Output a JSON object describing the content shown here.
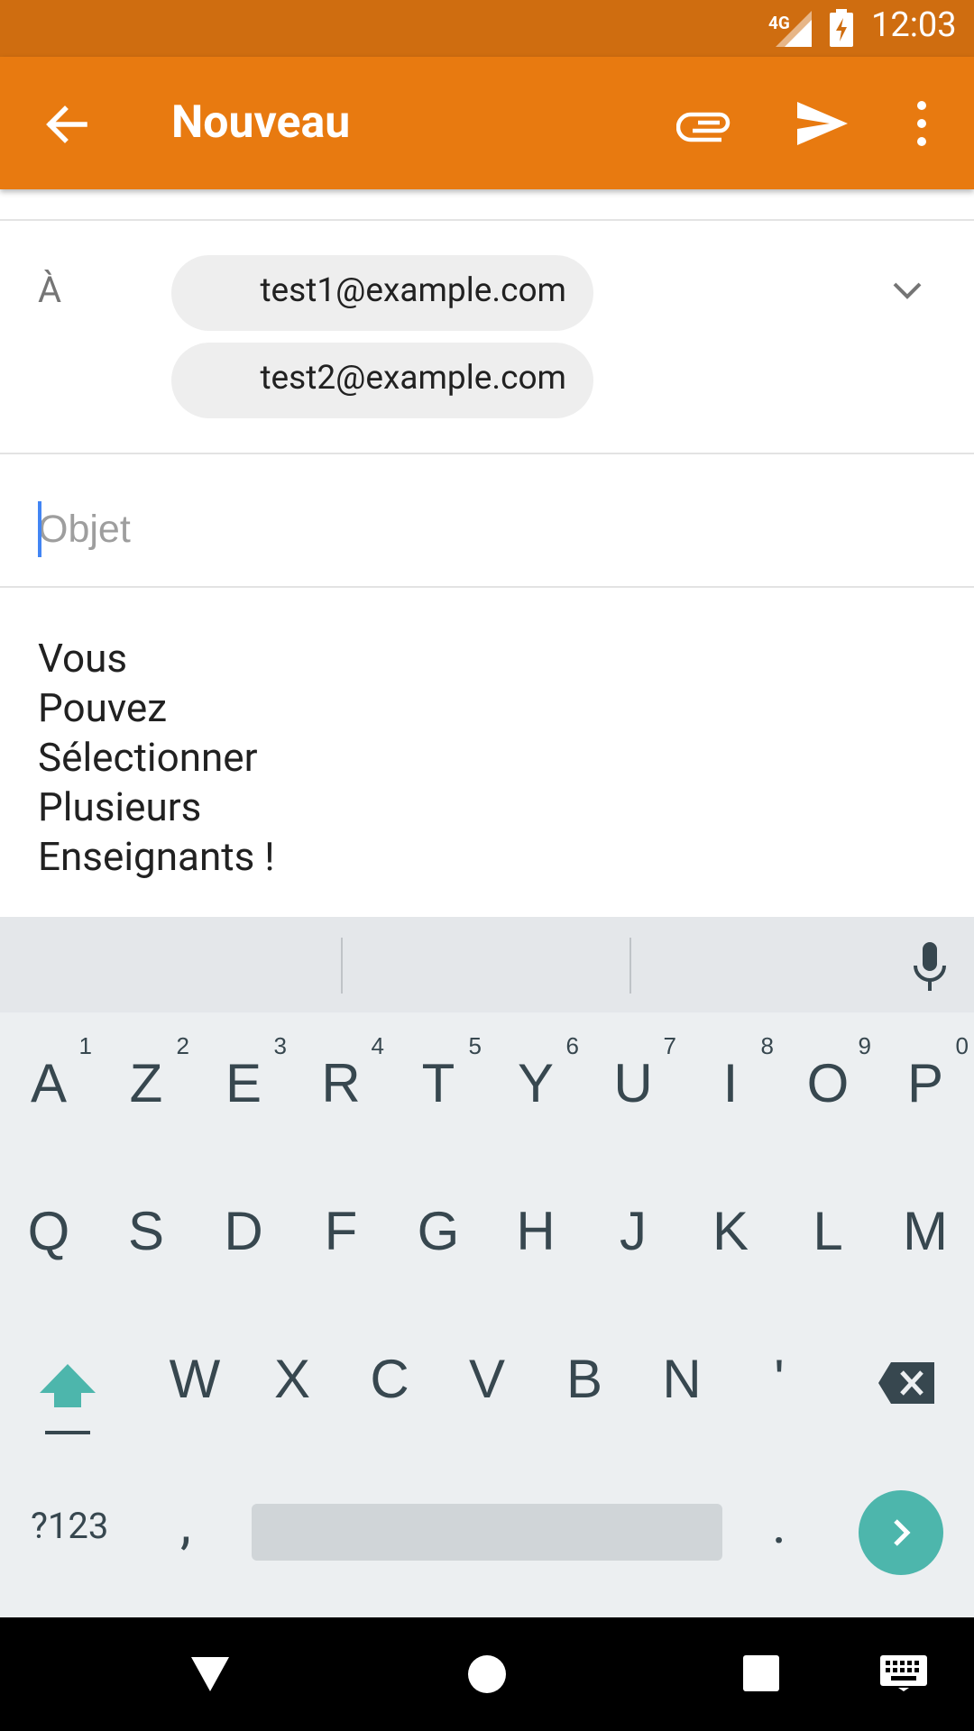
{
  "status_bar": {
    "network": "4G",
    "time": "12:03"
  },
  "app_bar": {
    "title": "Nouveau"
  },
  "compose": {
    "to_label": "À",
    "recipients": [
      "test1@example.com",
      "test2@example.com"
    ],
    "subject_placeholder": "Objet",
    "subject_value": "",
    "body_lines": [
      "Vous",
      "Pouvez",
      "Sélectionner",
      "Plusieurs",
      "Enseignants !"
    ]
  },
  "keyboard": {
    "row1": [
      {
        "key": "A",
        "hint": "1"
      },
      {
        "key": "Z",
        "hint": "2"
      },
      {
        "key": "E",
        "hint": "3"
      },
      {
        "key": "R",
        "hint": "4"
      },
      {
        "key": "T",
        "hint": "5"
      },
      {
        "key": "Y",
        "hint": "6"
      },
      {
        "key": "U",
        "hint": "7"
      },
      {
        "key": "I",
        "hint": "8"
      },
      {
        "key": "O",
        "hint": "9"
      },
      {
        "key": "P",
        "hint": "0"
      }
    ],
    "row2": [
      "Q",
      "S",
      "D",
      "F",
      "G",
      "H",
      "J",
      "K",
      "L",
      "M"
    ],
    "row3": [
      "W",
      "X",
      "C",
      "V",
      "B",
      "N",
      "'"
    ],
    "symbols_label": "?123",
    "comma": ",",
    "period": "."
  },
  "colors": {
    "accent": "#e87a10",
    "status_bar": "#cf6d10",
    "enter_key": "#4db6ac"
  }
}
